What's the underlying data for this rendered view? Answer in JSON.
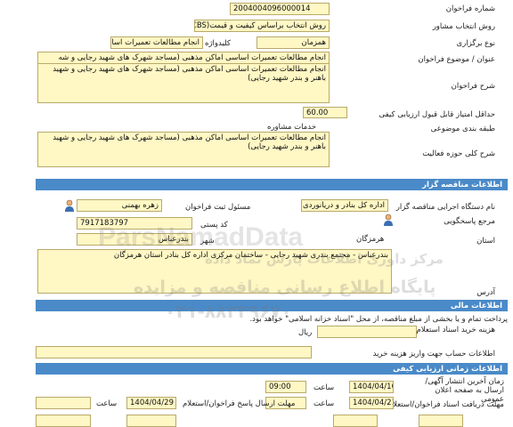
{
  "top": {
    "tender_number_label": "شماره فراخوان",
    "tender_number": "2004004096000014",
    "method_label": "روش انتخاب مشاور",
    "method_value": "روش انتخاب براساس کیفیت و قیمت(QCBS)",
    "type_label": "نوع برگزاری",
    "type_value": "همزمان",
    "keyword_label": "کلیدواژه",
    "keyword_value": "انجام مطالعات تعمیرات اسا",
    "title_label": "عنوان / موضوع فراخوان",
    "title_value": "انجام مطالعات تعمیرات اساسی اماکن مذهبی (مساجد شهرک های شهید رجایی و شه",
    "description_label": "شرح فراخوان",
    "description_value": "انجام مطالعات تعمیرات اساسی اماکن مذهبی (مساجد شهرک های شهید رجایی و شهید باهنر و بندر شهید رجایی)",
    "min_score_label": "حداقل امتیاز قابل قبول ارزیابی کیفی",
    "min_score_value": "60.00",
    "category_label": "طبقه بندی موضوعی",
    "category_value": "خدمات مشاوره",
    "activity_label": "شرح کلی حوزه فعالیت",
    "activity_value": "انجام مطالعات تعمیرات اساسی اماکن مذهبی (مساجد شهرک های شهید رجایی و شهید باهنر و بندر شهید رجایی)"
  },
  "organizer": {
    "section_title": "اطلاعات مناقصه گزار",
    "org_name_label": "نام دستگاه اجرایی مناقصه گزار",
    "org_name_value": "اداره کل بنادر و دریانوردی شه",
    "registrar_label": "مسئول ثبت فراخوان",
    "registrar_value": "زهره بهمنی",
    "response_ref_label": "مرجع پاسخگویی",
    "postal_label": "کد پستی",
    "postal_value": "7917183797",
    "province_label": "استان",
    "province_value": "هرمزگان",
    "city_label": "شهر",
    "city_value": "بندرعباس",
    "address_label": "آدرس",
    "address_value": "بندرعباس - مجتمع بندری شهید رجایی - ساختمان مرکزی اداره کل بنادر استان هرمزگان"
  },
  "financial": {
    "section_title": "اطلاعات مالی",
    "payment_note": "پرداخت تمام و یا بخشی از مبلغ مناقصه، از محل \"اسناد خزانه اسلامی\" خواهد بود.",
    "fee_label": "هزینه خرید اسناد استعلام ارزیابی کیفی",
    "fee_unit": "ریال",
    "account_label": "اطلاعات حساب جهت واریز هزینه خرید"
  },
  "schedule": {
    "section_title": "اطلاعات زمانی ارزیابی کیفی",
    "publish_label": "زمان آخرین انتشار آگهی/ارسال به صفحه اعلان عمومی",
    "publish_date": "1404/04/10",
    "publish_time": "09:00",
    "time_label": "ساعت",
    "deadline_label": "مهلت دریافت اسناد فراخوان/استعلام",
    "deadline_date": "1404/04/21",
    "deadline_time": "",
    "submit_label": "مهلت ارسال پاسخ فراخوان/استعلام",
    "submit_date": "1404/04/29",
    "submit_time": "",
    "time_label2": "ساعت",
    "time_label3": "ساعت"
  },
  "watermark": {
    "line1": "ParsNamadData",
    "line2": "مرکز داوری اطلاعات پارس نماد داده",
    "line3": "پایگاه اطلاع رسانی مناقصه و مزایده",
    "line4": "۰۲۱-۸۸۳۴۹۶۷۰"
  },
  "colors": {
    "section_bg": "#4a8ac8",
    "field_bg": "#fff7c4",
    "field_border": "#b9a96a"
  }
}
